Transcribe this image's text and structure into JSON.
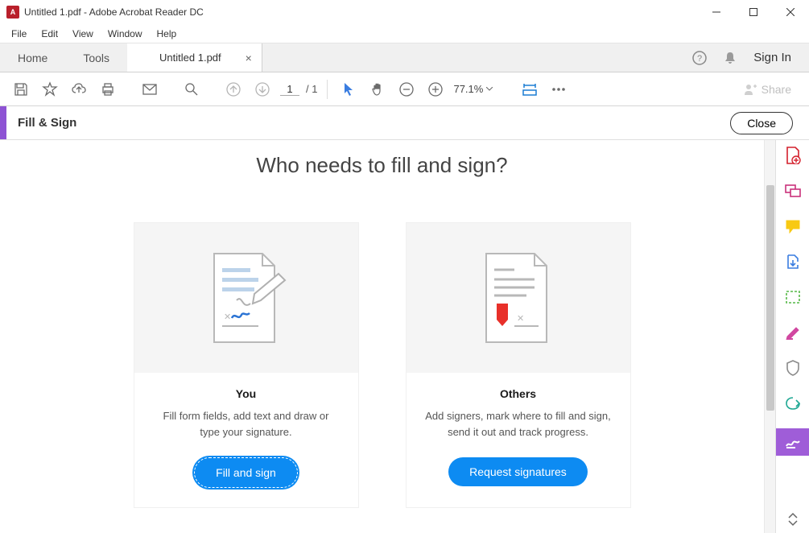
{
  "window": {
    "title": "Untitled 1.pdf - Adobe Acrobat Reader DC"
  },
  "menu": {
    "items": [
      "File",
      "Edit",
      "View",
      "Window",
      "Help"
    ]
  },
  "tabs": {
    "home": "Home",
    "tools": "Tools",
    "document": "Untitled 1.pdf",
    "signin": "Sign In"
  },
  "toolbar": {
    "page_current": "1",
    "page_total": "/ 1",
    "zoom": "77.1%"
  },
  "panel": {
    "title": "Fill & Sign",
    "close": "Close"
  },
  "share": "Share",
  "heading": "Who needs to fill and sign?",
  "cards": {
    "you": {
      "title": "You",
      "desc": "Fill form fields, add text and draw or type your signature.",
      "button": "Fill and sign"
    },
    "others": {
      "title": "Others",
      "desc": "Add signers, mark where to fill and sign, send it out and track progress.",
      "button": "Request signatures"
    }
  }
}
